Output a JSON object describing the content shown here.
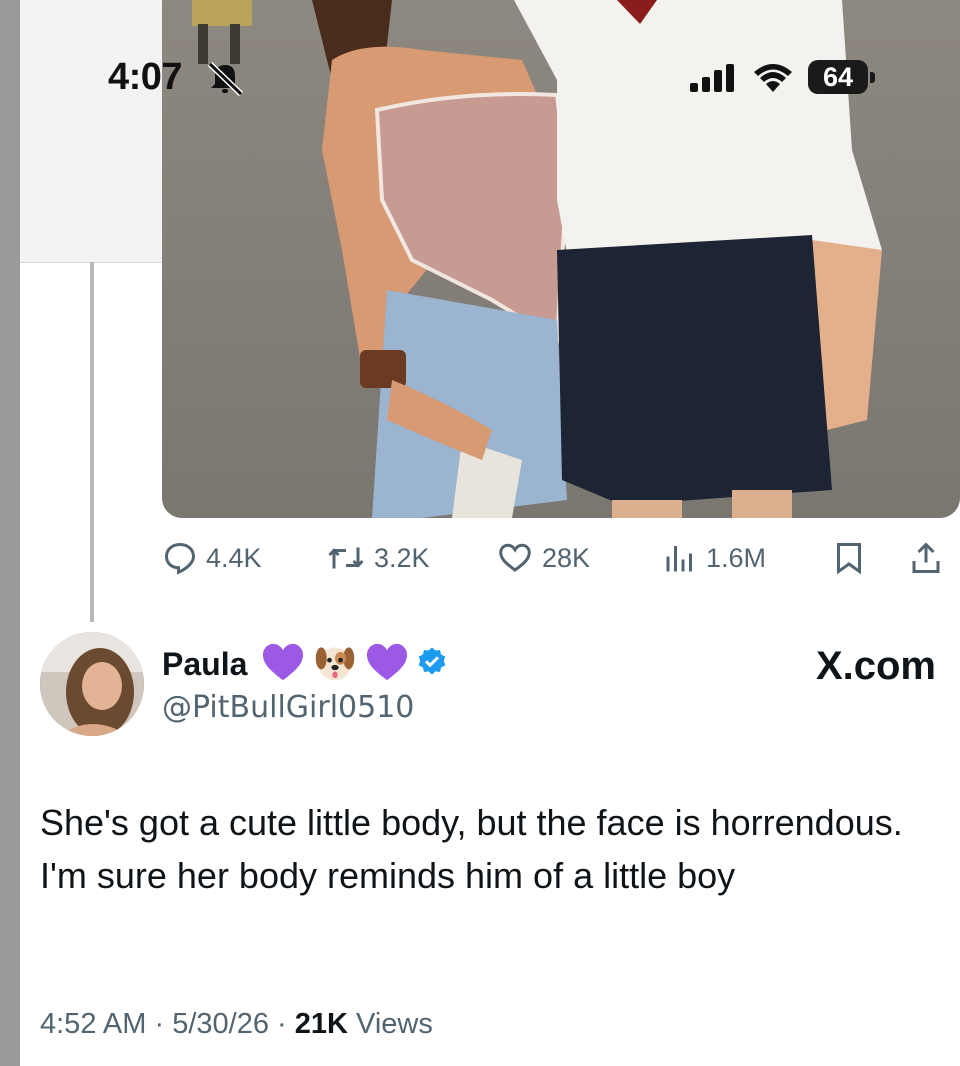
{
  "status_bar": {
    "time": "4:07",
    "battery": "64"
  },
  "icons": {
    "silent": "bell-slash-icon",
    "signal": "signal-bars-icon",
    "wifi": "wifi-icon",
    "reply": "speech-bubble-icon",
    "repost": "repost-arrows-icon",
    "like": "heart-outline-icon",
    "views": "bar-chart-icon",
    "bookmark": "bookmark-icon",
    "share": "share-upload-icon",
    "verified": "verified-badge-icon"
  },
  "post_actions": {
    "replies": "4.4K",
    "reposts": "3.2K",
    "likes": "28K",
    "views": "1.6M"
  },
  "reply": {
    "author_name": "Paula",
    "author_emojis": [
      "💜",
      "🐶",
      "💜"
    ],
    "handle": "@PitBullGirl0510",
    "source": "X.com",
    "text": "She's got a cute little body, but the face is horrendous. I'm sure her body reminds him of a little boy",
    "time": "4:52 AM",
    "date": "5/30/26",
    "views_count": "21K",
    "views_label": "Views",
    "separator": "·"
  },
  "colors": {
    "text_primary": "#0f1419",
    "text_secondary": "#536471",
    "verified": "#1d9bf0",
    "heart_purple": "#9b59e6"
  }
}
